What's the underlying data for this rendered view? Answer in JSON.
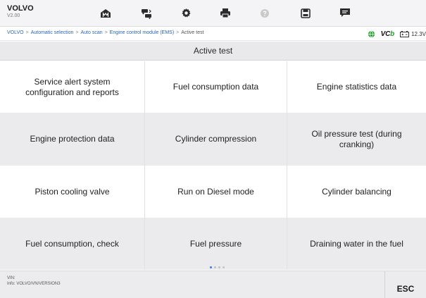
{
  "header": {
    "brand": "VOLVO",
    "version": "V2.00",
    "toolbar": [
      {
        "icon": "home-icon"
      },
      {
        "icon": "vehicle-swap-icon"
      },
      {
        "icon": "settings-gear-icon"
      },
      {
        "icon": "print-icon"
      },
      {
        "icon": "help-icon"
      },
      {
        "icon": "save-icon"
      },
      {
        "icon": "message-icon"
      }
    ]
  },
  "breadcrumb": {
    "items": [
      "VOLVO",
      "Automatic selection",
      "Auto scan",
      "Engine control module (EMS)"
    ],
    "separator": ">",
    "current": "Active test"
  },
  "status": {
    "vci_label_a": "VC",
    "vci_label_b": "b",
    "voltage": "12.3V"
  },
  "section": {
    "title": "Active test"
  },
  "tests": [
    {
      "label": "Service alert system configuration and reports"
    },
    {
      "label": "Fuel consumption data"
    },
    {
      "label": "Engine statistics data"
    },
    {
      "label": "Engine protection data"
    },
    {
      "label": "Cylinder compression"
    },
    {
      "label": "Oil pressure test (during cranking)"
    },
    {
      "label": "Piston cooling valve"
    },
    {
      "label": "Run on Diesel mode"
    },
    {
      "label": "Cylinder balancing"
    },
    {
      "label": "Fuel consumption, check"
    },
    {
      "label": "Fuel pressure"
    },
    {
      "label": "Draining water in the fuel"
    }
  ],
  "pager": {
    "pages": 4,
    "current": 1
  },
  "footer": {
    "vin_label": "VIN:",
    "info": "Info: VOLVO/VN/VERSION3",
    "esc_label": "ESC"
  },
  "colors": {
    "toolbar_background": "#f4f4f6",
    "link": "#2a64b8",
    "vci_green": "#25a032",
    "pager_active": "#3b7be0",
    "row_alt": "#ebebee"
  }
}
